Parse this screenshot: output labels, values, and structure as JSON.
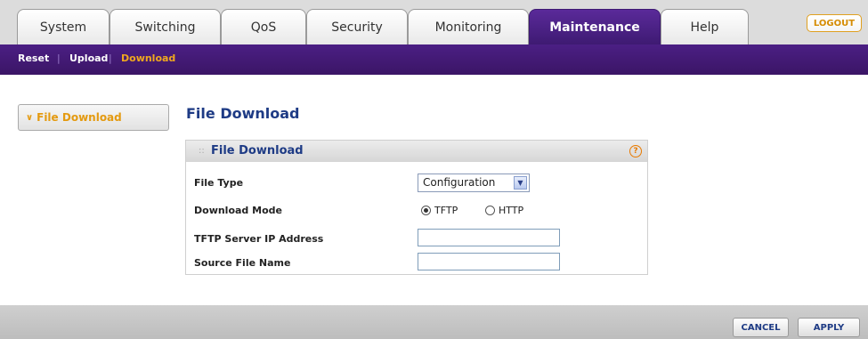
{
  "tabs": [
    {
      "label": "System"
    },
    {
      "label": "Switching"
    },
    {
      "label": "QoS"
    },
    {
      "label": "Security"
    },
    {
      "label": "Monitoring"
    },
    {
      "label": "Maintenance"
    },
    {
      "label": "Help"
    }
  ],
  "active_tab": "Maintenance",
  "logout_label": "LOGOUT",
  "subnav": [
    {
      "label": "Reset"
    },
    {
      "label": "Upload"
    },
    {
      "label": "Download"
    }
  ],
  "sidebar": {
    "item_label": "File Download",
    "arrow": "∨"
  },
  "page_title": "File Download",
  "panel": {
    "title": "File Download",
    "help_icon": "?",
    "file_type": {
      "label": "File Type",
      "value": "Configuration"
    },
    "download_mode": {
      "label": "Download Mode",
      "options": [
        {
          "label": "TFTP",
          "selected": true
        },
        {
          "label": "HTTP",
          "selected": false
        }
      ]
    },
    "tftp_server_ip": {
      "label": "TFTP Server IP Address",
      "value": ""
    },
    "source_file_name": {
      "label": "Source File Name",
      "value": ""
    }
  },
  "buttons": {
    "cancel": "CANCEL",
    "apply": "APPLY"
  },
  "colors": {
    "purple": "#4b1f84",
    "orange": "#e49a10",
    "title_blue": "#1e3b85"
  }
}
